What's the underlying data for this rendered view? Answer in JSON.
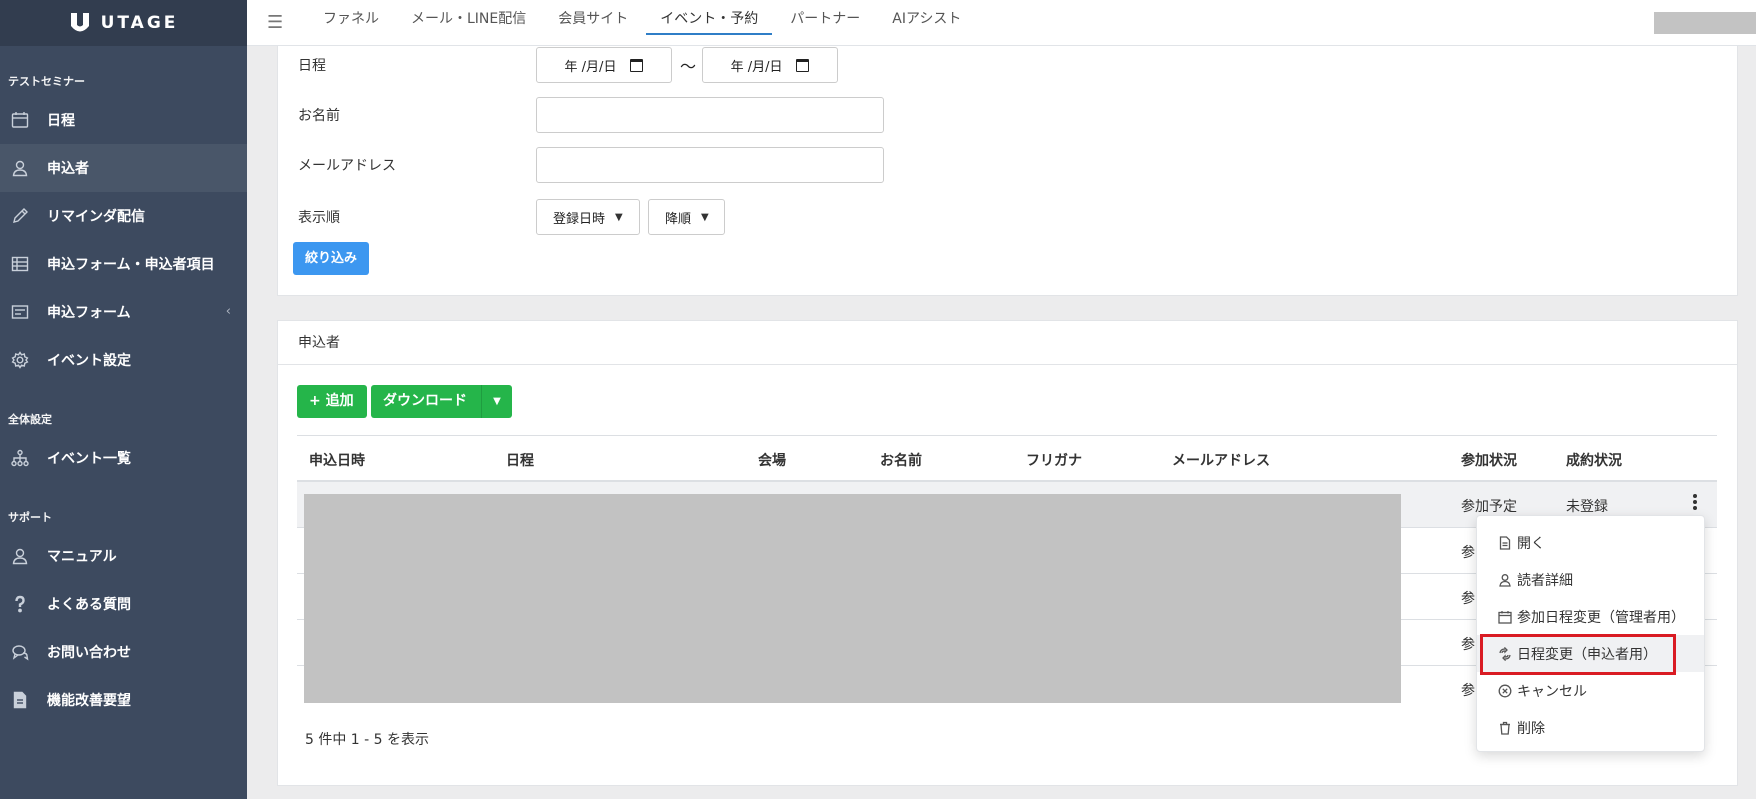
{
  "brand": {
    "name": "UTAGE"
  },
  "sidebar": {
    "section1": "テストセミナー",
    "section1_items": [
      {
        "label": "日程",
        "icon": "calendar-icon"
      },
      {
        "label": "申込者",
        "icon": "user-icon",
        "active": true
      },
      {
        "label": "リマインダ配信",
        "icon": "pencil-icon"
      },
      {
        "label": "申込フォーム・申込者項目",
        "icon": "table-icon"
      },
      {
        "label": "申込フォーム",
        "icon": "form-icon",
        "chevron": "‹"
      },
      {
        "label": "イベント設定",
        "icon": "gear-icon"
      }
    ],
    "section2": "全体設定",
    "section2_items": [
      {
        "label": "イベント一覧",
        "icon": "sitemap-icon"
      }
    ],
    "section3": "サポート",
    "section3_items": [
      {
        "label": "マニュアル",
        "icon": "user-icon"
      },
      {
        "label": "よくある質問",
        "icon": "question-icon"
      },
      {
        "label": "お問い合わせ",
        "icon": "chat-icon"
      },
      {
        "label": "機能改善要望",
        "icon": "document-icon"
      }
    ]
  },
  "topnav": {
    "tabs": [
      "ファネル",
      "メール・LINE配信",
      "会員サイト",
      "イベント・予約",
      "パートナー",
      "AIアシスト"
    ],
    "active_index": 3
  },
  "filter": {
    "date_label": "日程",
    "date_from": "年 /月/日",
    "date_to": "年 /月/日",
    "tilde": "〜",
    "name_label": "お名前",
    "email_label": "メールアドレス",
    "order_label": "表示順",
    "order_by": "登録日時",
    "order_dir": "降順",
    "submit": "絞り込み"
  },
  "applicants": {
    "title": "申込者",
    "add_button": "+ 追加",
    "download_button": "ダウンロード",
    "columns": [
      "申込日時",
      "日程",
      "会場",
      "お名前",
      "フリガナ",
      "メールアドレス",
      "参加状況",
      "成約状況"
    ],
    "rows": [
      {
        "status": "参加予定",
        "contract": "未登録"
      },
      {
        "status": "参"
      },
      {
        "status": "参"
      },
      {
        "status": "参"
      },
      {
        "status": "参"
      }
    ],
    "pagination": "5 件中 1 - 5 を表示"
  },
  "menu": {
    "items": [
      {
        "label": "開く",
        "icon": "file-icon"
      },
      {
        "label": "読者詳細",
        "icon": "user-icon"
      },
      {
        "label": "参加日程変更（管理者用）",
        "icon": "calendar-icon"
      },
      {
        "label": "日程変更（申込者用）",
        "icon": "refresh-icon"
      },
      {
        "label": "キャンセル",
        "icon": "cancel-circle-icon"
      },
      {
        "label": "削除",
        "icon": "trash-icon"
      }
    ]
  }
}
